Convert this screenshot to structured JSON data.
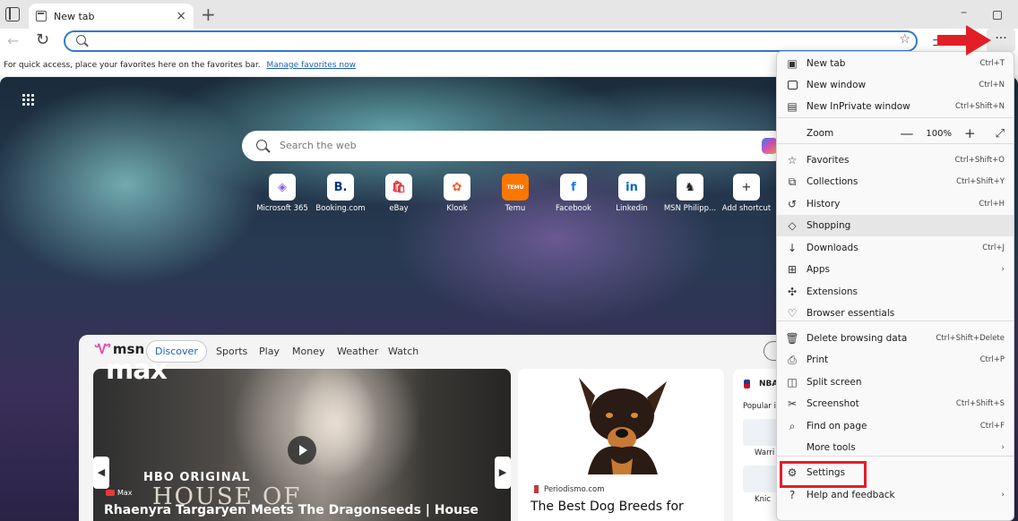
{
  "browser": {
    "tab_title": "New tab",
    "tab_close": "×",
    "new_tab": "+",
    "minimize": "–",
    "more_label": "···"
  },
  "favbar": {
    "text": "For quick access, place your favorites here on the favorites bar.",
    "link": "Manage favorites now"
  },
  "newtab": {
    "search_placeholder": "Search the web",
    "shortcuts": [
      {
        "label": "Microsoft 365",
        "glyph": "◈",
        "color": "#8b5cf6"
      },
      {
        "label": "Booking.com",
        "glyph": "B.",
        "color": "#003580"
      },
      {
        "label": "eBay",
        "glyph": "🛍",
        "color": "#e53238"
      },
      {
        "label": "Klook",
        "glyph": "✿",
        "color": "#ff5722"
      },
      {
        "label": "Temu",
        "glyph": "TEMU",
        "color": "#fb7701"
      },
      {
        "label": "Facebook",
        "glyph": "f",
        "color": "#1877f2"
      },
      {
        "label": "Linkedin",
        "glyph": "in",
        "color": "#0a66c2"
      },
      {
        "label": "MSN Philipp...",
        "glyph": "♞",
        "color": "#222222"
      },
      {
        "label": "Add shortcut",
        "glyph": "+",
        "color": "#555555"
      }
    ]
  },
  "feed": {
    "logo": "msn",
    "tabs": [
      "Discover",
      "Sports",
      "Play",
      "Money",
      "Weather",
      "Watch"
    ],
    "main_card": {
      "brand": "max",
      "badge": "HBO ORIGINAL",
      "show": "HOUSE OF",
      "source": "Max",
      "title": "Rhaenyra Targaryen Meets The Dragonseeds | House",
      "prev": "◀",
      "next": "▶"
    },
    "dog_card": {
      "source": "Periodismo.com",
      "title": "The Best Dog Breeds for"
    },
    "nba_card": {
      "label": "NBA",
      "popular": "Popular i",
      "teams": [
        "Warri",
        "Knic"
      ]
    }
  },
  "menu": {
    "items": [
      {
        "label": "New tab",
        "shortcut": "Ctrl+T",
        "icon": "new-tab-icon"
      },
      {
        "label": "New window",
        "shortcut": "Ctrl+N",
        "icon": "new-window-icon"
      },
      {
        "label": "New InPrivate window",
        "shortcut": "Ctrl+Shift+N",
        "icon": "inprivate-icon"
      },
      {
        "label": "Zoom",
        "icon": "zoom"
      },
      {
        "label": "Favorites",
        "shortcut": "Ctrl+Shift+O",
        "icon": "favorites-icon"
      },
      {
        "label": "Collections",
        "shortcut": "Ctrl+Shift+Y",
        "icon": "collections-icon"
      },
      {
        "label": "History",
        "shortcut": "Ctrl+H",
        "icon": "history-icon"
      },
      {
        "label": "Shopping",
        "shortcut": "",
        "icon": "shopping-tag-icon"
      },
      {
        "label": "Downloads",
        "shortcut": "Ctrl+J",
        "icon": "download-icon"
      },
      {
        "label": "Apps",
        "shortcut": "",
        "icon": "apps-icon",
        "submenu": true
      },
      {
        "label": "Extensions",
        "shortcut": "",
        "icon": "extensions-icon"
      },
      {
        "label": "Browser essentials",
        "shortcut": "",
        "icon": "heart-pulse-icon"
      },
      {
        "label": "Delete browsing data",
        "shortcut": "Ctrl+Shift+Delete",
        "icon": "trash-icon"
      },
      {
        "label": "Print",
        "shortcut": "Ctrl+P",
        "icon": "print-icon"
      },
      {
        "label": "Split screen",
        "shortcut": "",
        "icon": "split-screen-icon"
      },
      {
        "label": "Screenshot",
        "shortcut": "Ctrl+Shift+S",
        "icon": "screenshot-icon"
      },
      {
        "label": "Find on page",
        "shortcut": "Ctrl+F",
        "icon": "find-icon"
      },
      {
        "label": "More tools",
        "shortcut": "",
        "icon": "",
        "submenu": true
      },
      {
        "label": "Settings",
        "shortcut": "",
        "icon": "gear-icon"
      },
      {
        "label": "Help and feedback",
        "shortcut": "",
        "icon": "help-icon",
        "submenu": true
      }
    ],
    "zoom": {
      "minus": "—",
      "value": "100%",
      "plus": "+",
      "fullscreen": "⤢"
    }
  },
  "annotation": {
    "box_color": "#e21f26",
    "arrow_color": "#e21f26"
  }
}
